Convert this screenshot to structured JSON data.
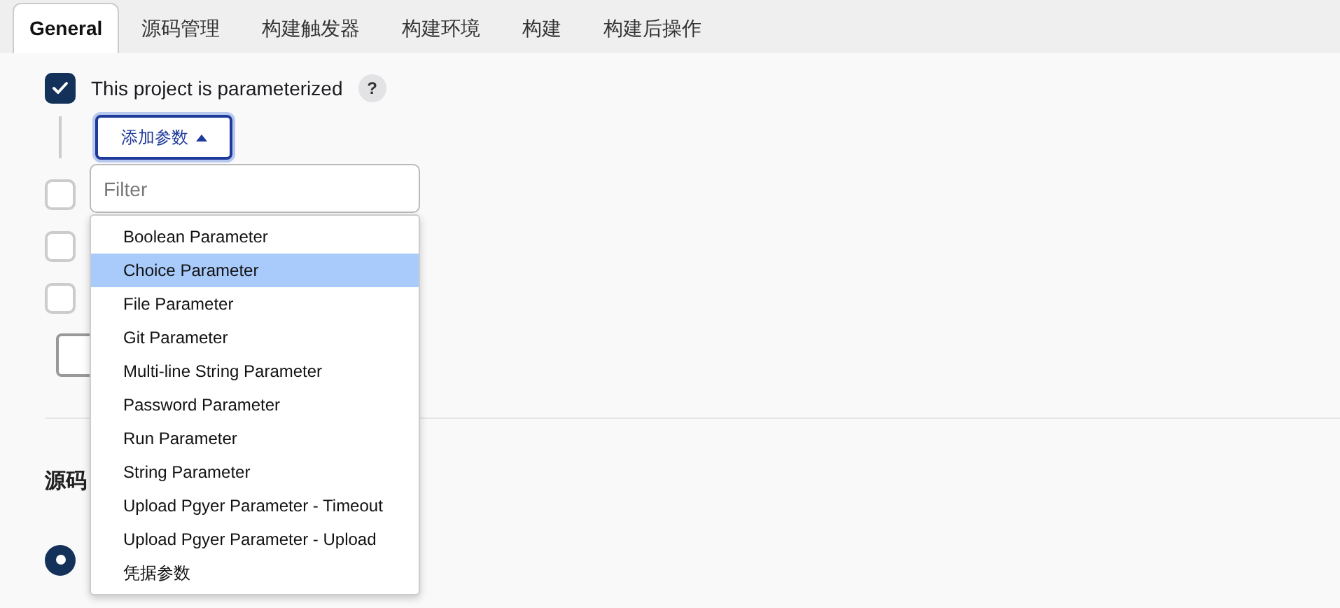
{
  "tabs": [
    {
      "label": "General",
      "selected": true
    },
    {
      "label": "源码管理",
      "selected": false
    },
    {
      "label": "构建触发器",
      "selected": false
    },
    {
      "label": "构建环境",
      "selected": false
    },
    {
      "label": "构建",
      "selected": false
    },
    {
      "label": "构建后操作",
      "selected": false
    }
  ],
  "parameterized": {
    "label": "This project is parameterized",
    "checked": true,
    "help": "?"
  },
  "add_parameter_button": {
    "label": "添加参数",
    "expanded": true
  },
  "filter": {
    "placeholder": "Filter"
  },
  "menu": [
    {
      "label": "Boolean Parameter",
      "selected": false
    },
    {
      "label": "Choice Parameter",
      "selected": true
    },
    {
      "label": "File Parameter",
      "selected": false
    },
    {
      "label": "Git Parameter",
      "selected": false
    },
    {
      "label": "Multi-line String Parameter",
      "selected": false
    },
    {
      "label": "Password Parameter",
      "selected": false
    },
    {
      "label": "Run Parameter",
      "selected": false
    },
    {
      "label": "String Parameter",
      "selected": false
    },
    {
      "label": "Upload Pgyer Parameter - Timeout",
      "selected": false
    },
    {
      "label": "Upload Pgyer Parameter - Upload",
      "selected": false
    },
    {
      "label": "凭据参数",
      "selected": false
    }
  ],
  "options": [
    {
      "checked": false
    },
    {
      "checked": false
    },
    {
      "checked": false
    }
  ],
  "section_heading": "源码",
  "scm_radio": {
    "selected": true
  }
}
